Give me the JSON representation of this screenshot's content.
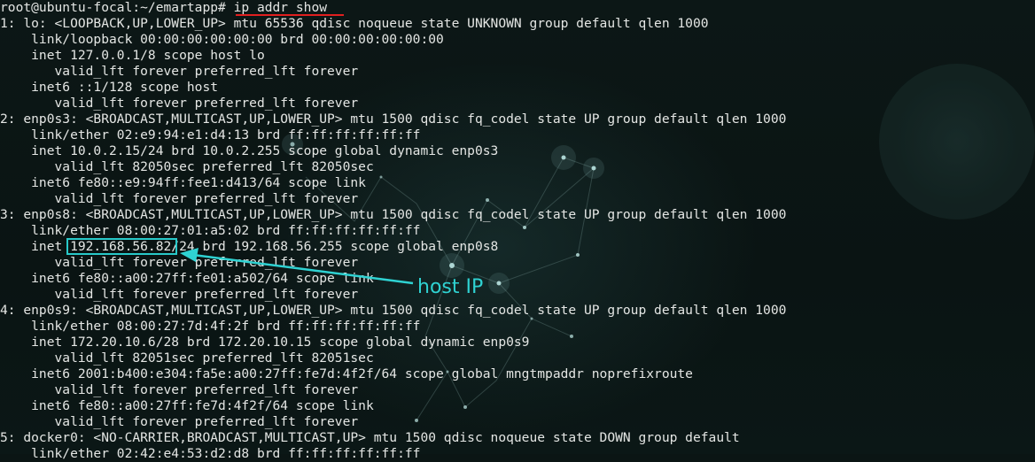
{
  "terminal": {
    "lines": [
      "root@ubuntu-focal:~/emartapp# ip addr show",
      "1: lo: <LOOPBACK,UP,LOWER_UP> mtu 65536 qdisc noqueue state UNKNOWN group default qlen 1000",
      "    link/loopback 00:00:00:00:00:00 brd 00:00:00:00:00:00",
      "    inet 127.0.0.1/8 scope host lo",
      "       valid_lft forever preferred_lft forever",
      "    inet6 ::1/128 scope host",
      "       valid_lft forever preferred_lft forever",
      "2: enp0s3: <BROADCAST,MULTICAST,UP,LOWER_UP> mtu 1500 qdisc fq_codel state UP group default qlen 1000",
      "    link/ether 02:e9:94:e1:d4:13 brd ff:ff:ff:ff:ff:ff",
      "    inet 10.0.2.15/24 brd 10.0.2.255 scope global dynamic enp0s3",
      "       valid_lft 82050sec preferred_lft 82050sec",
      "    inet6 fe80::e9:94ff:fee1:d413/64 scope link",
      "       valid_lft forever preferred_lft forever",
      "3: enp0s8: <BROADCAST,MULTICAST,UP,LOWER_UP> mtu 1500 qdisc fq_codel state UP group default qlen 1000",
      "    link/ether 08:00:27:01:a5:02 brd ff:ff:ff:ff:ff:ff",
      "    inet 192.168.56.82/24 brd 192.168.56.255 scope global enp0s8",
      "       valid_lft forever preferred_lft forever",
      "    inet6 fe80::a00:27ff:fe01:a502/64 scope link",
      "       valid_lft forever preferred_lft forever",
      "4: enp0s9: <BROADCAST,MULTICAST,UP,LOWER_UP> mtu 1500 qdisc fq_codel state UP group default qlen 1000",
      "    link/ether 08:00:27:7d:4f:2f brd ff:ff:ff:ff:ff:ff",
      "    inet 172.20.10.6/28 brd 172.20.10.15 scope global dynamic enp0s9",
      "       valid_lft 82051sec preferred_lft 82051sec",
      "    inet6 2001:b400:e304:fa5e:a00:27ff:fe7d:4f2f/64 scope global mngtmpaddr noprefixroute",
      "       valid_lft forever preferred_lft forever",
      "    inet6 fe80::a00:27ff:fe7d:4f2f/64 scope link",
      "       valid_lft forever preferred_lft forever",
      "5: docker0: <NO-CARRIER,BROADCAST,MULTICAST,UP> mtu 1500 qdisc noqueue state DOWN group default",
      "    link/ether 02:42:e4:53:d2:d8 brd ff:ff:ff:ff:ff:ff"
    ]
  },
  "annotation": {
    "label": "host IP",
    "color": "#2fd2d2",
    "box_color": "#28c9c9",
    "underline_color": "#e11f1f"
  },
  "icons": {
    "arrow": "arrow-left-icon"
  }
}
